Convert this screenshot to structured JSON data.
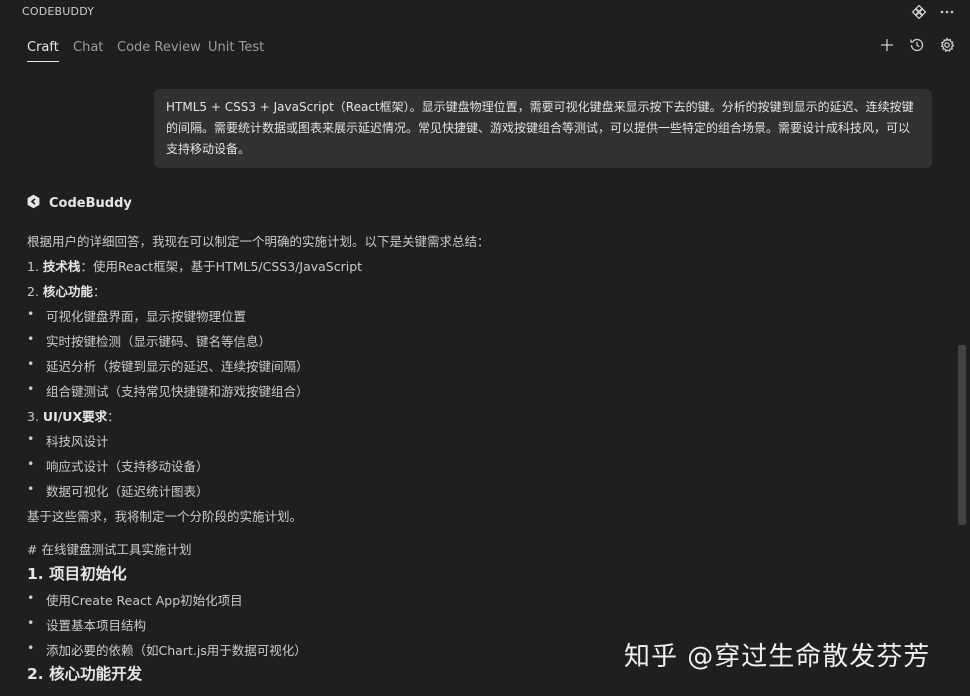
{
  "app": {
    "title": "CODEBUDDY"
  },
  "tabs": [
    {
      "label": "Craft",
      "active": true
    },
    {
      "label": "Chat"
    },
    {
      "label": "Code Review"
    },
    {
      "label": "Unit Test"
    }
  ],
  "toolbar_icons": [
    "plugin-icon",
    "more-icon",
    "add-icon",
    "history-icon",
    "settings-icon"
  ],
  "user_message": "HTML5 + CSS3 + JavaScript（React框架）。显示键盘物理位置，需要可视化键盘来显示按下去的键。分析的按键到显示的延迟、连续按键的间隔。需要统计数据或图表来展示延迟情况。常见快捷键、游戏按键组合等测试，可以提供一些特定的组合场景。需要设计成科技风，可以支持移动设备。",
  "assistant": {
    "name": "CodeBuddy",
    "intro": "根据用户的详细回答，我现在可以制定一个明确的实施计划。以下是关键需求总结：",
    "item1_num": "1.",
    "item1_bold": "技术栈",
    "item1_rest": "：使用React框架，基于HTML5/CSS3/JavaScript",
    "item2_num": "2.",
    "item2_bold": "核心功能",
    "item2_rest": "：",
    "core_bullets": [
      "可视化键盘界面，显示按键物理位置",
      "实时按键检测（显示键码、键名等信息）",
      "延迟分析（按键到显示的延迟、连续按键间隔）",
      "组合键测试（支持常见快捷键和游戏按键组合）"
    ],
    "item3_num": "3.",
    "item3_bold": "UI/UX要求",
    "item3_rest": "：",
    "ui_bullets": [
      "科技风设计",
      "响应式设计（支持移动设备）",
      "数据可视化（延迟统计图表）"
    ],
    "conclusion": "基于这些需求，我将制定一个分阶段的实施计划。",
    "plan_title": "# 在线键盘测试工具实施计划",
    "section1_title": "1. 项目初始化",
    "section1_bullets": [
      "使用Create React App初始化项目",
      "设置基本项目结构",
      "添加必要的依赖（如Chart.js用于数据可视化）"
    ],
    "section2_title": "2. 核心功能开发"
  },
  "watermark": "知乎 @穿过生命散发芬芳"
}
